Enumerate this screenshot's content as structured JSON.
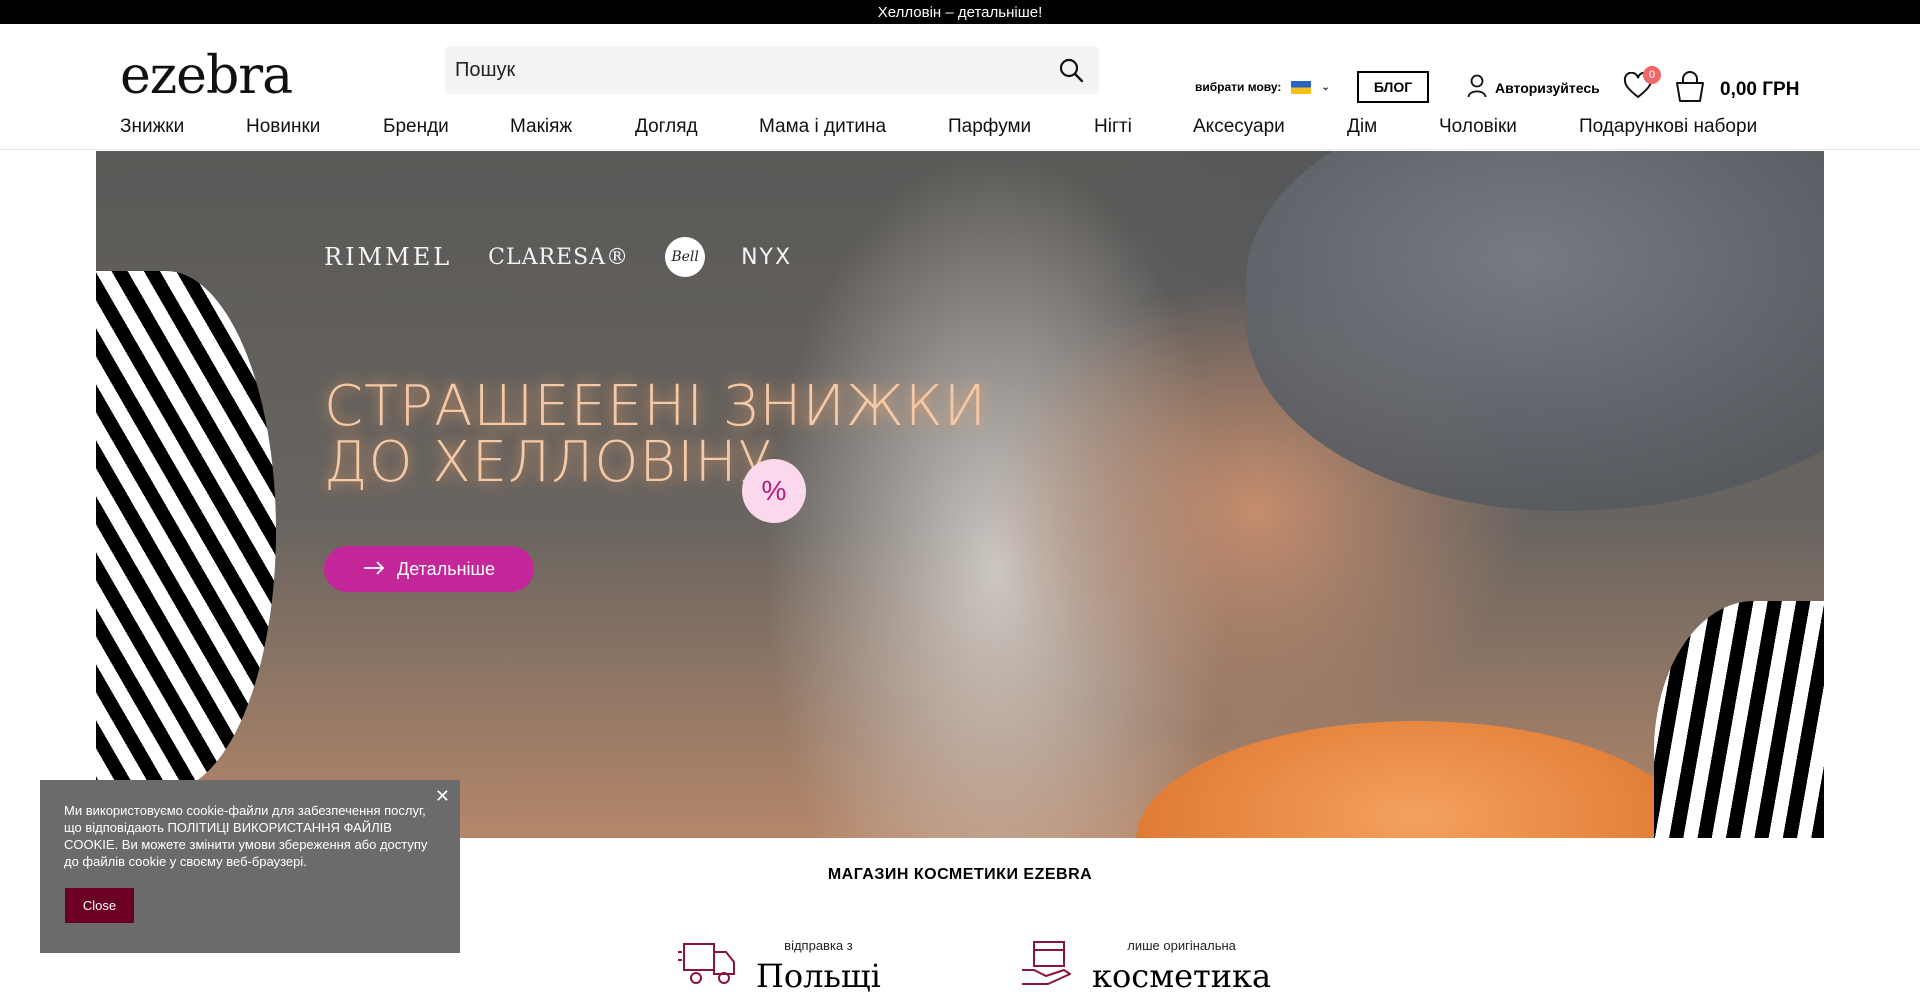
{
  "topbar": {
    "text": "Хелловін – детальніше!"
  },
  "header": {
    "logo": {
      "e": "e",
      "rest": "zebra"
    },
    "search": {
      "placeholder": "Пошук"
    },
    "language": {
      "label": "вибрати мову:",
      "icon": "ua-flag-icon"
    },
    "blog_label": "БЛОГ",
    "auth_label": "Авторизуйтесь",
    "wishlist_count": "0",
    "cart_total": "0,00 ГРН"
  },
  "nav": {
    "items": [
      "Знижки",
      "Новинки",
      "Бренди",
      "Макіяж",
      "Догляд",
      "Мама і дитина",
      "Парфуми",
      "Нігті",
      "Аксесуари",
      "Дім",
      "Чоловіки",
      "Подарункові набори"
    ]
  },
  "hero": {
    "brands": [
      "RIMMEL",
      "CLARESA®",
      "Bell",
      "NYX"
    ],
    "title_line1": "СТРАШЕЕЕНІ ЗНИЖКИ",
    "title_line2": "ДО ХЕЛЛОВІНУ",
    "percent": "%",
    "button_label": "Детальніше"
  },
  "section": {
    "title": "МАГАЗИН КОСМЕТИКИ EZEBRA"
  },
  "features": [
    {
      "small": "відправка з",
      "big": "Польщі",
      "icon": "delivery-truck-icon"
    },
    {
      "small": "лише оригінальна",
      "big": "косметика",
      "icon": "box-hand-icon"
    }
  ],
  "cookie": {
    "text": "Ми використовуємо cookie-файли для забезпечення послуг, що відповідають ПОЛІТИЦІ ВИКОРИСТАННЯ ФАЙЛІВ COOKIE. Ви можете змінити умови збереження або доступу до файлів cookie у своєму веб-браузері.",
    "close_label": "Close"
  },
  "colors": {
    "accent": "#c3279a",
    "cookie_button": "#6b0024",
    "badge": "#f06767",
    "feature_icon": "#8a1538"
  }
}
